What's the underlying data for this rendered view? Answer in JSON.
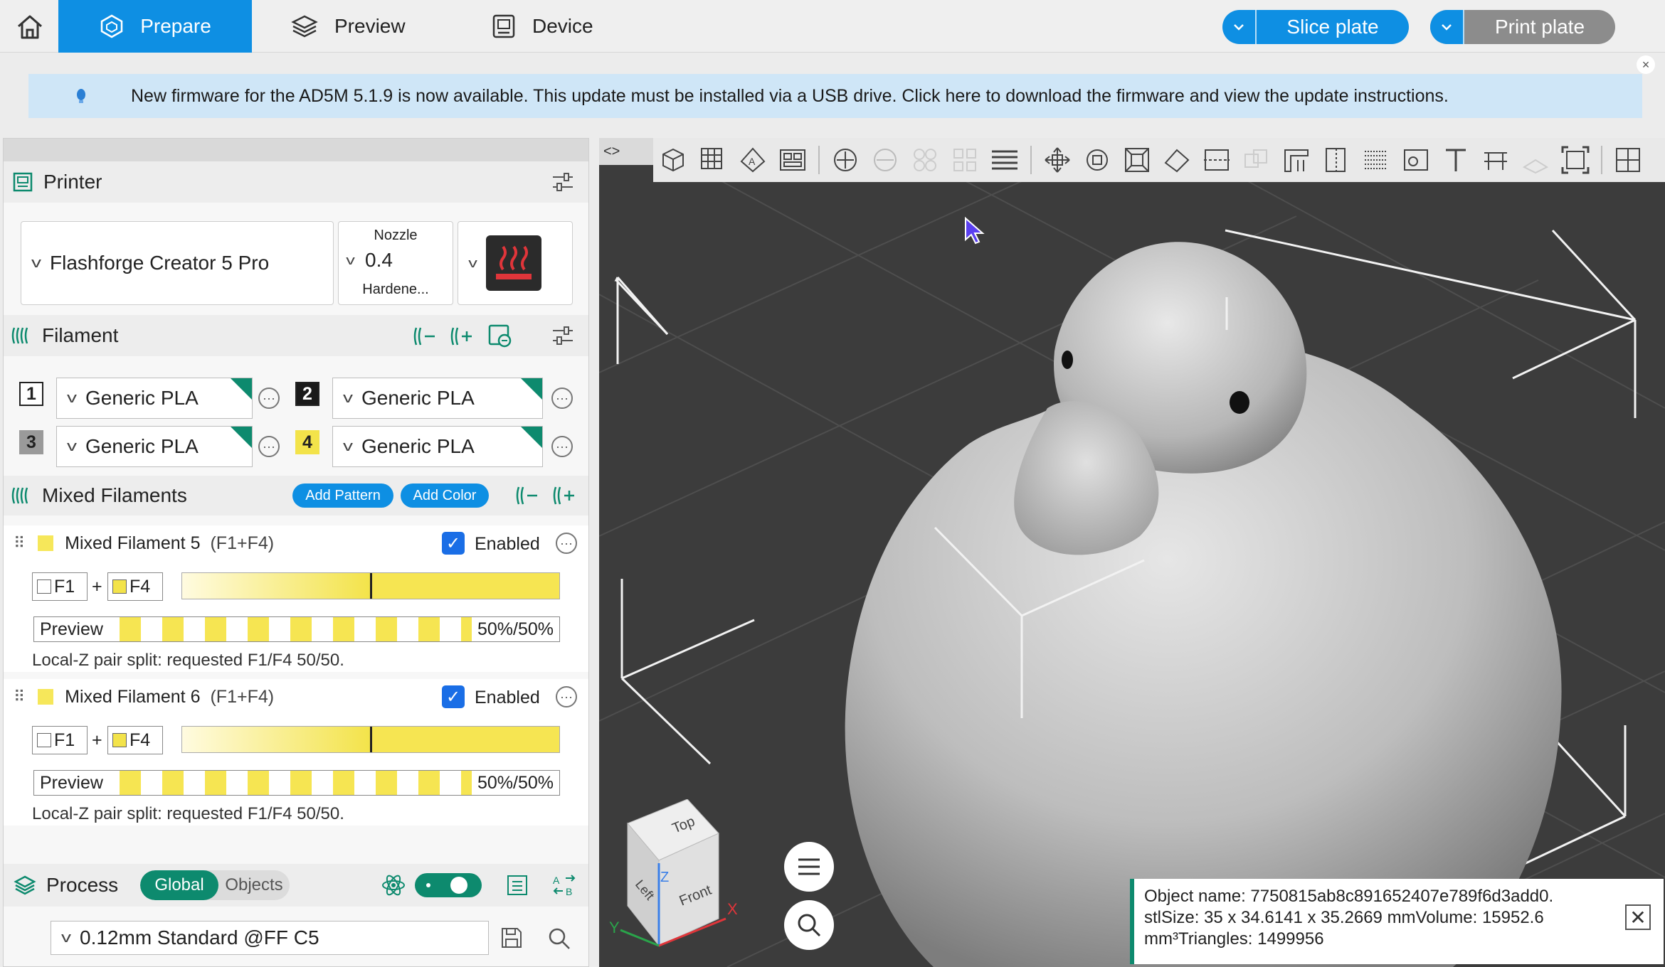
{
  "topbar": {
    "tabs": {
      "prepare": "Prepare",
      "preview": "Preview",
      "device": "Device"
    },
    "slice_label": "Slice plate",
    "print_label": "Print plate",
    "accent": "#0e8fe3"
  },
  "notice": {
    "text": "New firmware for the AD5M 5.1.9 is now available. This update must be installed via a USB drive. Click here to download the firmware and view the update instructions.",
    "close": "×"
  },
  "printer": {
    "title": "Printer",
    "model": "Flashforge Creator 5 Pro",
    "nozzle_label": "Nozzle",
    "nozzle_value": "0.4",
    "nozzle_type": "Hardene..."
  },
  "filament": {
    "title": "Filament",
    "slots": [
      {
        "num": "1",
        "name": "Generic PLA",
        "color": "#ffffff"
      },
      {
        "num": "2",
        "name": "Generic PLA",
        "color": "#1a1a1a"
      },
      {
        "num": "3",
        "name": "Generic PLA",
        "color": "#9a9a9a"
      },
      {
        "num": "4",
        "name": "Generic PLA",
        "color": "#f3e34a"
      }
    ],
    "more": "···"
  },
  "mixed": {
    "title": "Mixed Filaments",
    "add_pattern": "Add Pattern",
    "add_color": "Add Color",
    "items": [
      {
        "name": "Mixed Filament 5",
        "components": "(F1+F4)",
        "enabled_label": "Enabled",
        "a": "F1",
        "plus": "+",
        "b": "F4",
        "preview_label": "Preview",
        "ratio": "50%/50%",
        "ratio_value": 0.5,
        "note": "Local-Z pair split: requested F1/F4 50/50."
      },
      {
        "name": "Mixed Filament 6",
        "components": "(F1+F4)",
        "enabled_label": "Enabled",
        "a": "F1",
        "plus": "+",
        "b": "F4",
        "preview_label": "Preview",
        "ratio": "50%/50%",
        "ratio_value": 0.5,
        "note": "Local-Z pair split: requested F1/F4 50/50."
      }
    ]
  },
  "process": {
    "title": "Process",
    "global": "Global",
    "objects": "Objects",
    "preset": "0.12mm Standard @FF C5"
  },
  "viewport": {
    "collapse": "<>",
    "cube": {
      "top": "Top",
      "front": "Front",
      "left": "Left"
    },
    "axes": {
      "x": "X",
      "y": "Y",
      "z": "Z"
    }
  },
  "object_info": {
    "line1": "Object name: 7750815ab8c891652407e789f6d3add0.",
    "line2": "stlSize: 35 x 34.6141 x 35.2669 mmVolume: 15952.6",
    "line3": "mm³Triangles: 1499956",
    "close": "✕"
  }
}
